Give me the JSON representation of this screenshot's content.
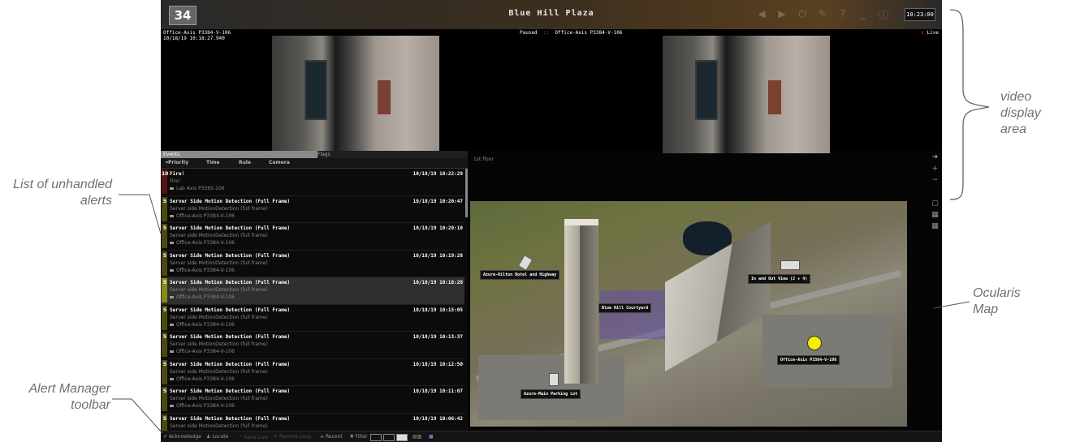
{
  "app": {
    "logo": "34",
    "title": "Blue Hill Plaza",
    "clock": "10:23:00"
  },
  "video": {
    "left_camera": "Office-Axis P3384-V-106",
    "left_timestamp": "10/18/19 10:18:27.940",
    "paused_label": "Paused",
    "right_camera": "Office-Axis P3384-V-106",
    "live_label": "Live"
  },
  "events_panel": {
    "tabs": [
      "Events",
      "Flags"
    ],
    "columns": [
      "▾Priority",
      "Time",
      "Rule",
      "Camera"
    ],
    "events": [
      {
        "priority": "10",
        "title": "Fire!",
        "time": "10/18/19 10:22:29",
        "desc": "Fire!",
        "camera": "Lab Axis P3365-106",
        "kind": "fire"
      },
      {
        "priority": "5",
        "title": "Server Side Motion Detection (Full Frame)",
        "time": "10/18/19 10:20:47",
        "desc": "Server side MotionDetection (full frame)",
        "camera": "Office-Axis P3384-V-106",
        "kind": "normal"
      },
      {
        "priority": "5",
        "title": "Server Side Motion Detection (Full Frame)",
        "time": "10/18/19 10:20:10",
        "desc": "Server side MotionDetection (full frame)",
        "camera": "Office-Axis P3384-V-106",
        "kind": "normal"
      },
      {
        "priority": "5",
        "title": "Server Side Motion Detection (Full Frame)",
        "time": "10/18/19 10:19:28",
        "desc": "Server side MotionDetection (full frame)",
        "camera": "Office-Axis P3384-V-106",
        "kind": "normal"
      },
      {
        "priority": "5",
        "title": "Server Side Motion Detection (Full Frame)",
        "time": "10/18/19 10:18:28",
        "desc": "Server side MotionDetection (full frame)",
        "camera": "Office-Axis P3384-V-106",
        "kind": "selected"
      },
      {
        "priority": "5",
        "title": "Server Side Motion Detection (Full Frame)",
        "time": "10/18/19 10:15:05",
        "desc": "Server side MotionDetection (full frame)",
        "camera": "Office-Axis P3384-V-106",
        "kind": "normal"
      },
      {
        "priority": "5",
        "title": "Server Side Motion Detection (Full Frame)",
        "time": "10/18/19 10:13:37",
        "desc": "Server side MotionDetection (full frame)",
        "camera": "Office-Axis P3384-V-106",
        "kind": "normal"
      },
      {
        "priority": "5",
        "title": "Server Side Motion Detection (Full Frame)",
        "time": "10/18/19 10:12:50",
        "desc": "Server side MotionDetection (full frame)",
        "camera": "Office-Axis P3384-V-106",
        "kind": "normal"
      },
      {
        "priority": "5",
        "title": "Server Side Motion Detection (Full Frame)",
        "time": "10/18/19 10:11:07",
        "desc": "Server side MotionDetection (full frame)",
        "camera": "Office-Axis P3384-V-106",
        "kind": "normal"
      },
      {
        "priority": "5",
        "title": "Server Side Motion Detection (Full Frame)",
        "time": "10/18/19 10:06:42",
        "desc": "Server side MotionDetection (full frame)",
        "camera": "",
        "kind": "normal"
      }
    ]
  },
  "toolbar": {
    "acknowledge": "Acknowledge",
    "locate": "Locate",
    "send_live": "Send Live",
    "remote_loop": "Remote Loop",
    "recent": "Recent",
    "filter": "Filter"
  },
  "map": {
    "floor": "1st floor",
    "labels": {
      "hilton": "Azure-Hilton Hotel and Highway",
      "inout": "In and Out View (2 + 4)",
      "courtyard": "Blue Hill Courtyard",
      "office": "Office-Axis P3384-V-106",
      "parking": "Azure-Main Parking Lot"
    }
  },
  "annotations": {
    "video_area": "video display area",
    "unhandled": "List of unhandled alerts",
    "map": "Ocularis Map",
    "toolbar": "Alert Manager toolbar"
  },
  "colors": {
    "fire_bar": "#5a1010",
    "normal_bar": "#4a4a10",
    "selected_bar": "#8a8a18",
    "active_pin": "#f2f000"
  }
}
